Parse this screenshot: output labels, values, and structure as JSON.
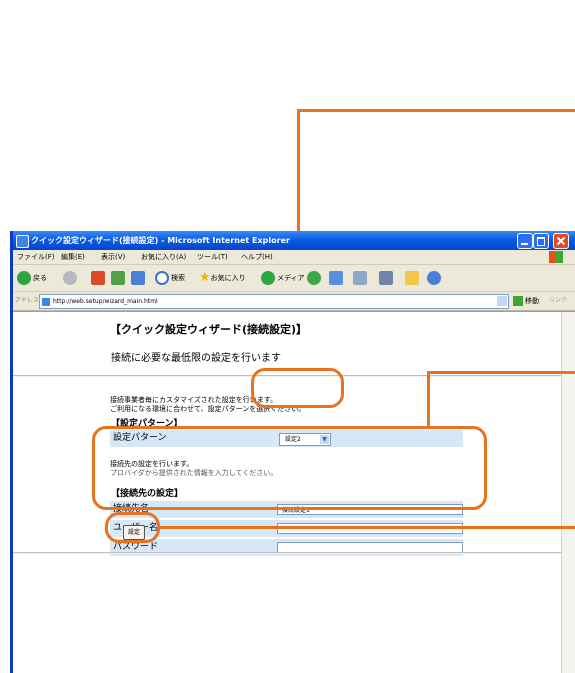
{
  "window": {
    "title": "クイック設定ウィザード(接続設定) - Microsoft Internet Explorer"
  },
  "menu": [
    "ファイル(F)",
    "編集(E)",
    "表示(V)",
    "お気に入り(A)",
    "ツール(T)",
    "ヘルプ(H)"
  ],
  "toolbar": {
    "back": "戻る",
    "search": "検索",
    "favorites": "お気に入り",
    "media": "メディア"
  },
  "address": {
    "label": "アドレス(D)",
    "url": "http://web.setup/wizard_main.html",
    "go": "移動",
    "links": "リンク"
  },
  "page": {
    "title": "【クイック設定ウィザード(接続設定)】",
    "lead": "接続に必要な最低限の設定を行います",
    "pattern_note_1": "接続事業者毎にカスタマイズされた設定を行います。",
    "pattern_note_2": "ご利用になる環境に合わせて、設定パターンを選択ください。",
    "pattern_heading": "【設定パターン】",
    "pattern_label": "設定パターン",
    "pattern_value": "設定2",
    "connection_note_1": "接続先の設定を行います。",
    "connection_note_2": "プロバイダから提供された情報を入力してください。",
    "connection_heading": "【接続先の設定】",
    "fields": [
      {
        "label": "接続先名",
        "value": "接続設定1"
      },
      {
        "label": "ユーザー名",
        "value": ""
      },
      {
        "label": "パスワード",
        "value": ""
      }
    ],
    "submit": "設定"
  },
  "colors": {
    "callout": "#E8721E",
    "row_bg": "#D6E8F8",
    "titlebar": "#0A5CE6"
  }
}
